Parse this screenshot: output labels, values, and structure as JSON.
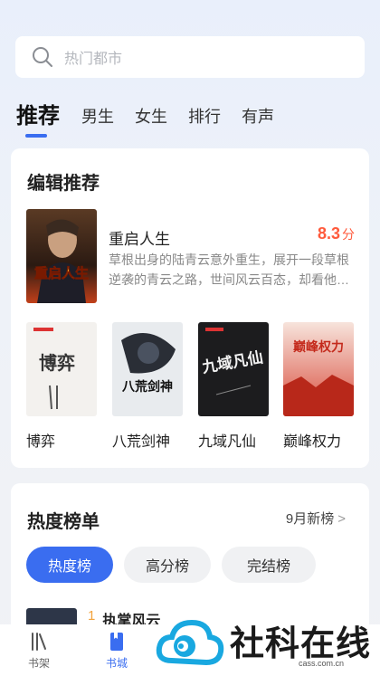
{
  "search": {
    "placeholder": "热门都市"
  },
  "tabs": [
    {
      "label": "推荐",
      "active": true
    },
    {
      "label": "男生"
    },
    {
      "label": "女生"
    },
    {
      "label": "排行"
    },
    {
      "label": "有声"
    }
  ],
  "editor_pick": {
    "title": "编辑推荐",
    "featured": {
      "name": "重启人生",
      "score": "8.3",
      "score_unit": "分",
      "description": "草根出身的陆青云意外重生，展开一段草根逆袭的青云之路，世间风云百态，却看他…",
      "cover_text": "重启人生"
    },
    "books": [
      {
        "title": "博弈",
        "cover_text": "博弈"
      },
      {
        "title": "八荒剑神",
        "cover_text": "八荒剑神"
      },
      {
        "title": "九域凡仙",
        "cover_text": "九域凡仙"
      },
      {
        "title": "巅峰权力",
        "cover_text": "巅峰权力"
      }
    ]
  },
  "ranking": {
    "title": "热度榜单",
    "more_label": "9月新榜",
    "pills": [
      {
        "label": "热度榜",
        "active": true
      },
      {
        "label": "高分榜"
      },
      {
        "label": "完结榜"
      }
    ],
    "first": {
      "rank": "1",
      "name": "执掌风云"
    }
  },
  "bottom_nav": [
    {
      "label": "书架",
      "icon": "bookshelf-icon"
    },
    {
      "label": "书城",
      "icon": "book-icon",
      "active": true
    }
  ],
  "watermark": {
    "text": "社科在线",
    "sub": "cass.com.cn"
  },
  "colors": {
    "accent": "#3a6df0",
    "score": "#ff5a3c",
    "rank_num": "#f2a23c"
  }
}
